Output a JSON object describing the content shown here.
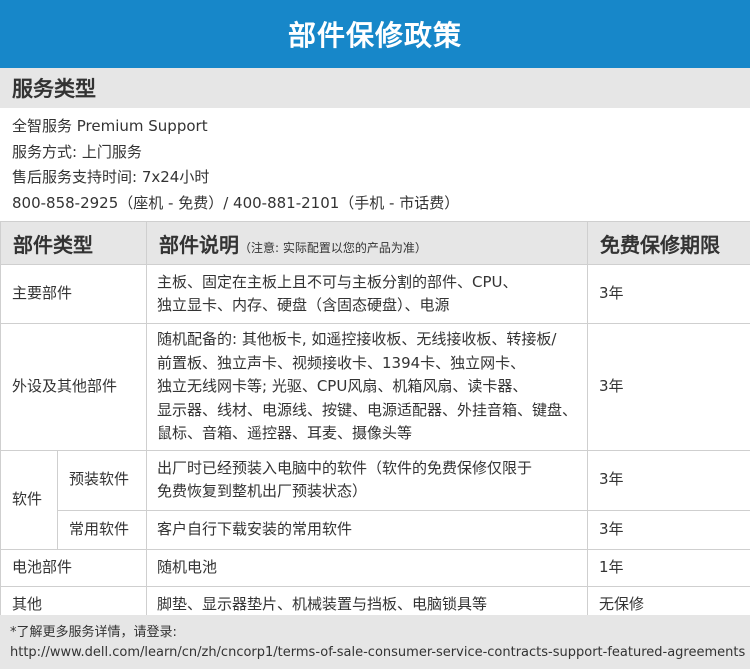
{
  "header": {
    "title": "部件保修政策"
  },
  "service": {
    "section_title": "服务类型",
    "lines": [
      "全智服务 Premium Support",
      "服务方式: 上门服务",
      "售后服务支持时间: 7x24小时",
      "800-858-2925（座机 - 免费）/ 400-881-2101（手机 - 市话费）"
    ]
  },
  "table": {
    "headers": {
      "type": "部件类型",
      "desc": "部件说明",
      "desc_note": "（注意: 实际配置以您的产品为准）",
      "warranty": "免费保修期限"
    },
    "rows": {
      "main": {
        "type": "主要部件",
        "desc": [
          "主板、固定在主板上且不可与主板分割的部件、CPU、",
          "独立显卡、内存、硬盘（含固态硬盘）、电源"
        ],
        "warranty": "3年"
      },
      "peripheral": {
        "type": "外设及其他部件",
        "desc": [
          "随机配备的: 其他板卡, 如遥控接收板、无线接收板、转接板/",
          "前置板、独立声卡、视频接收卡、1394卡、独立网卡、",
          "独立无线网卡等; 光驱、CPU风扇、机箱风扇、读卡器、",
          "显示器、线材、电源线、按键、电源适配器、外挂音箱、键盘、",
          "鼠标、音箱、遥控器、耳麦、摄像头等"
        ],
        "warranty": "3年"
      },
      "software": {
        "type": "软件",
        "preinstalled": {
          "sub": "预装软件",
          "desc": [
            "出厂时已经预装入电脑中的软件（软件的免费保修仅限于",
            "免费恢复到整机出厂预装状态）"
          ],
          "warranty": "3年"
        },
        "common": {
          "sub": "常用软件",
          "desc": "客户自行下载安装的常用软件",
          "warranty": "3年"
        }
      },
      "battery": {
        "type": "电池部件",
        "desc": "随机电池",
        "warranty": "1年"
      },
      "other": {
        "type": "其他",
        "desc": "脚垫、显示器垫片、机械装置与挡板、电脑锁具等",
        "warranty": "无保修"
      }
    }
  },
  "footer": {
    "note": "*了解更多服务详情，请登录:",
    "url": "http://www.dell.com/learn/cn/zh/cncorp1/terms-of-sale-consumer-service-contracts-support-featured-agreements"
  },
  "colors": {
    "header_bg": "#1787c9",
    "section_bg": "#e6e6e6",
    "border": "#cfcfcf"
  }
}
